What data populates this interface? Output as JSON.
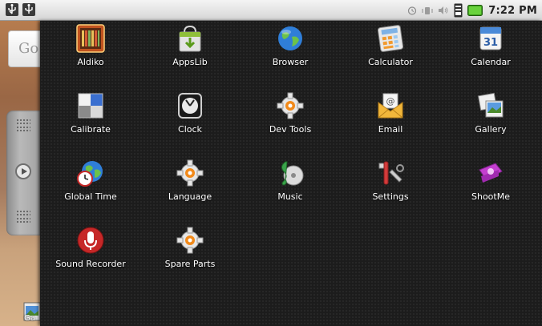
{
  "status_bar": {
    "time": "7:22 PM",
    "icons": [
      "usb-icon",
      "usb-debug-icon",
      "alarm-icon",
      "vibrate-icon",
      "volume-icon",
      "signal-icon",
      "battery-icon"
    ]
  },
  "home": {
    "search_stub_text": "Go",
    "gallery_stub_label": "Ga"
  },
  "drawer": {
    "apps": [
      {
        "label": "Aldiko",
        "icon": "books-icon"
      },
      {
        "label": "AppsLib",
        "icon": "shopping-bag-icon"
      },
      {
        "label": "Browser",
        "icon": "globe-icon"
      },
      {
        "label": "Calculator",
        "icon": "calculator-icon"
      },
      {
        "label": "Calendar",
        "icon": "calendar-icon"
      },
      {
        "label": "Calibrate",
        "icon": "calibrate-icon"
      },
      {
        "label": "Clock",
        "icon": "clock-icon"
      },
      {
        "label": "Dev Tools",
        "icon": "gear-icon"
      },
      {
        "label": "Email",
        "icon": "envelope-icon"
      },
      {
        "label": "Gallery",
        "icon": "photos-icon"
      },
      {
        "label": "Global Time",
        "icon": "globe-clock-icon"
      },
      {
        "label": "Language",
        "icon": "gear-icon"
      },
      {
        "label": "Music",
        "icon": "music-icon"
      },
      {
        "label": "Settings",
        "icon": "tools-icon"
      },
      {
        "label": "ShootMe",
        "icon": "camera-icon"
      },
      {
        "label": "Sound Recorder",
        "icon": "microphone-icon"
      },
      {
        "label": "Spare Parts",
        "icon": "gear-icon"
      }
    ],
    "calendar_day": "31"
  }
}
